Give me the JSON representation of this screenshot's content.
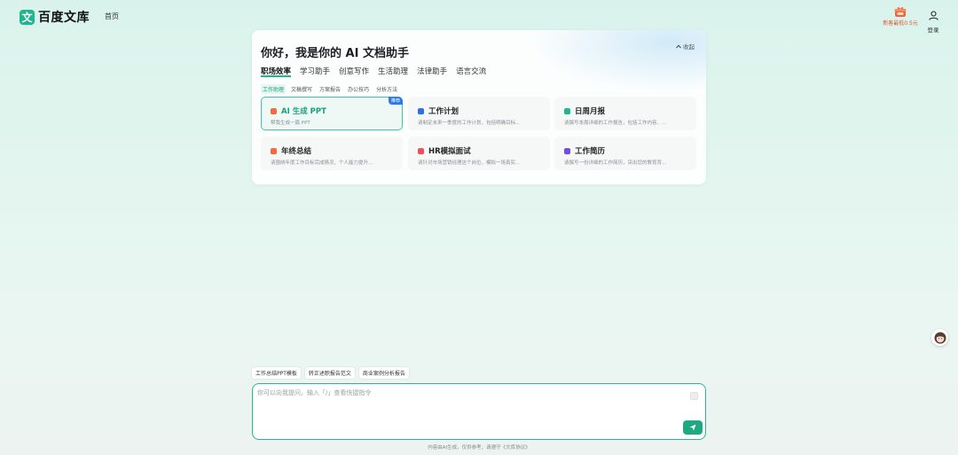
{
  "header": {
    "logo_mark": "文",
    "logo_text": "百度文库",
    "nav_home": "首页",
    "promo_text": "新客最低0.5元",
    "login_label": "登录"
  },
  "panel": {
    "greeting": "你好，我是你的 AI 文档助手",
    "collapse_label": "收起",
    "tabs": [
      {
        "label": "职场效率",
        "active": true
      },
      {
        "label": "学习助手"
      },
      {
        "label": "创意写作"
      },
      {
        "label": "生活助理"
      },
      {
        "label": "法律助手"
      },
      {
        "label": "语言交流"
      }
    ],
    "subtabs": [
      {
        "label": "工作助理",
        "active": true
      },
      {
        "label": "文稿撰写"
      },
      {
        "label": "方案报告"
      },
      {
        "label": "办公技巧"
      },
      {
        "label": "分析方法"
      }
    ],
    "cards": [
      {
        "title": "AI 生成 PPT",
        "desc": "帮我生成一篇 PPT",
        "badge": "推荐",
        "icon_color": "#f26a3d",
        "icon": "ppt-icon"
      },
      {
        "title": "工作计划",
        "desc": "请制定未来一季度的工作计划，包括明确目标...",
        "icon_color": "#2f6fe4",
        "icon": "plan-icon"
      },
      {
        "title": "日周月报",
        "desc": "请撰写本周详细的工作报告，包括工作内容、...",
        "icon_color": "#1fb58f",
        "icon": "report-icon"
      },
      {
        "title": "年终总结",
        "desc": "请围绕年度工作目标完成情况、个人能力提升...",
        "icon_color": "#f26a3d",
        "icon": "summary-icon"
      },
      {
        "title": "HR模拟面试",
        "desc": "请针对市场营销经理这个岗位，模拟一场真实...",
        "icon_color": "#ef4f5f",
        "icon": "interview-icon"
      },
      {
        "title": "工作简历",
        "desc": "请撰写一份详细的工作简历，突出您的教育背...",
        "icon_color": "#7a4be0",
        "icon": "resume-icon"
      }
    ]
  },
  "suggestions": [
    "工作总结PPT模板",
    "转正述职报告范文",
    "商业案例分析报告"
  ],
  "input": {
    "placeholder": "你可以向我提问，输入「/」查看快捷指令"
  },
  "disclaimer": "内容由AI生成，仅供参考，请遵守《文库协议》",
  "colors": {
    "accent": "#1fb58f",
    "border": "#25b991",
    "badge": "#2c78f0"
  }
}
